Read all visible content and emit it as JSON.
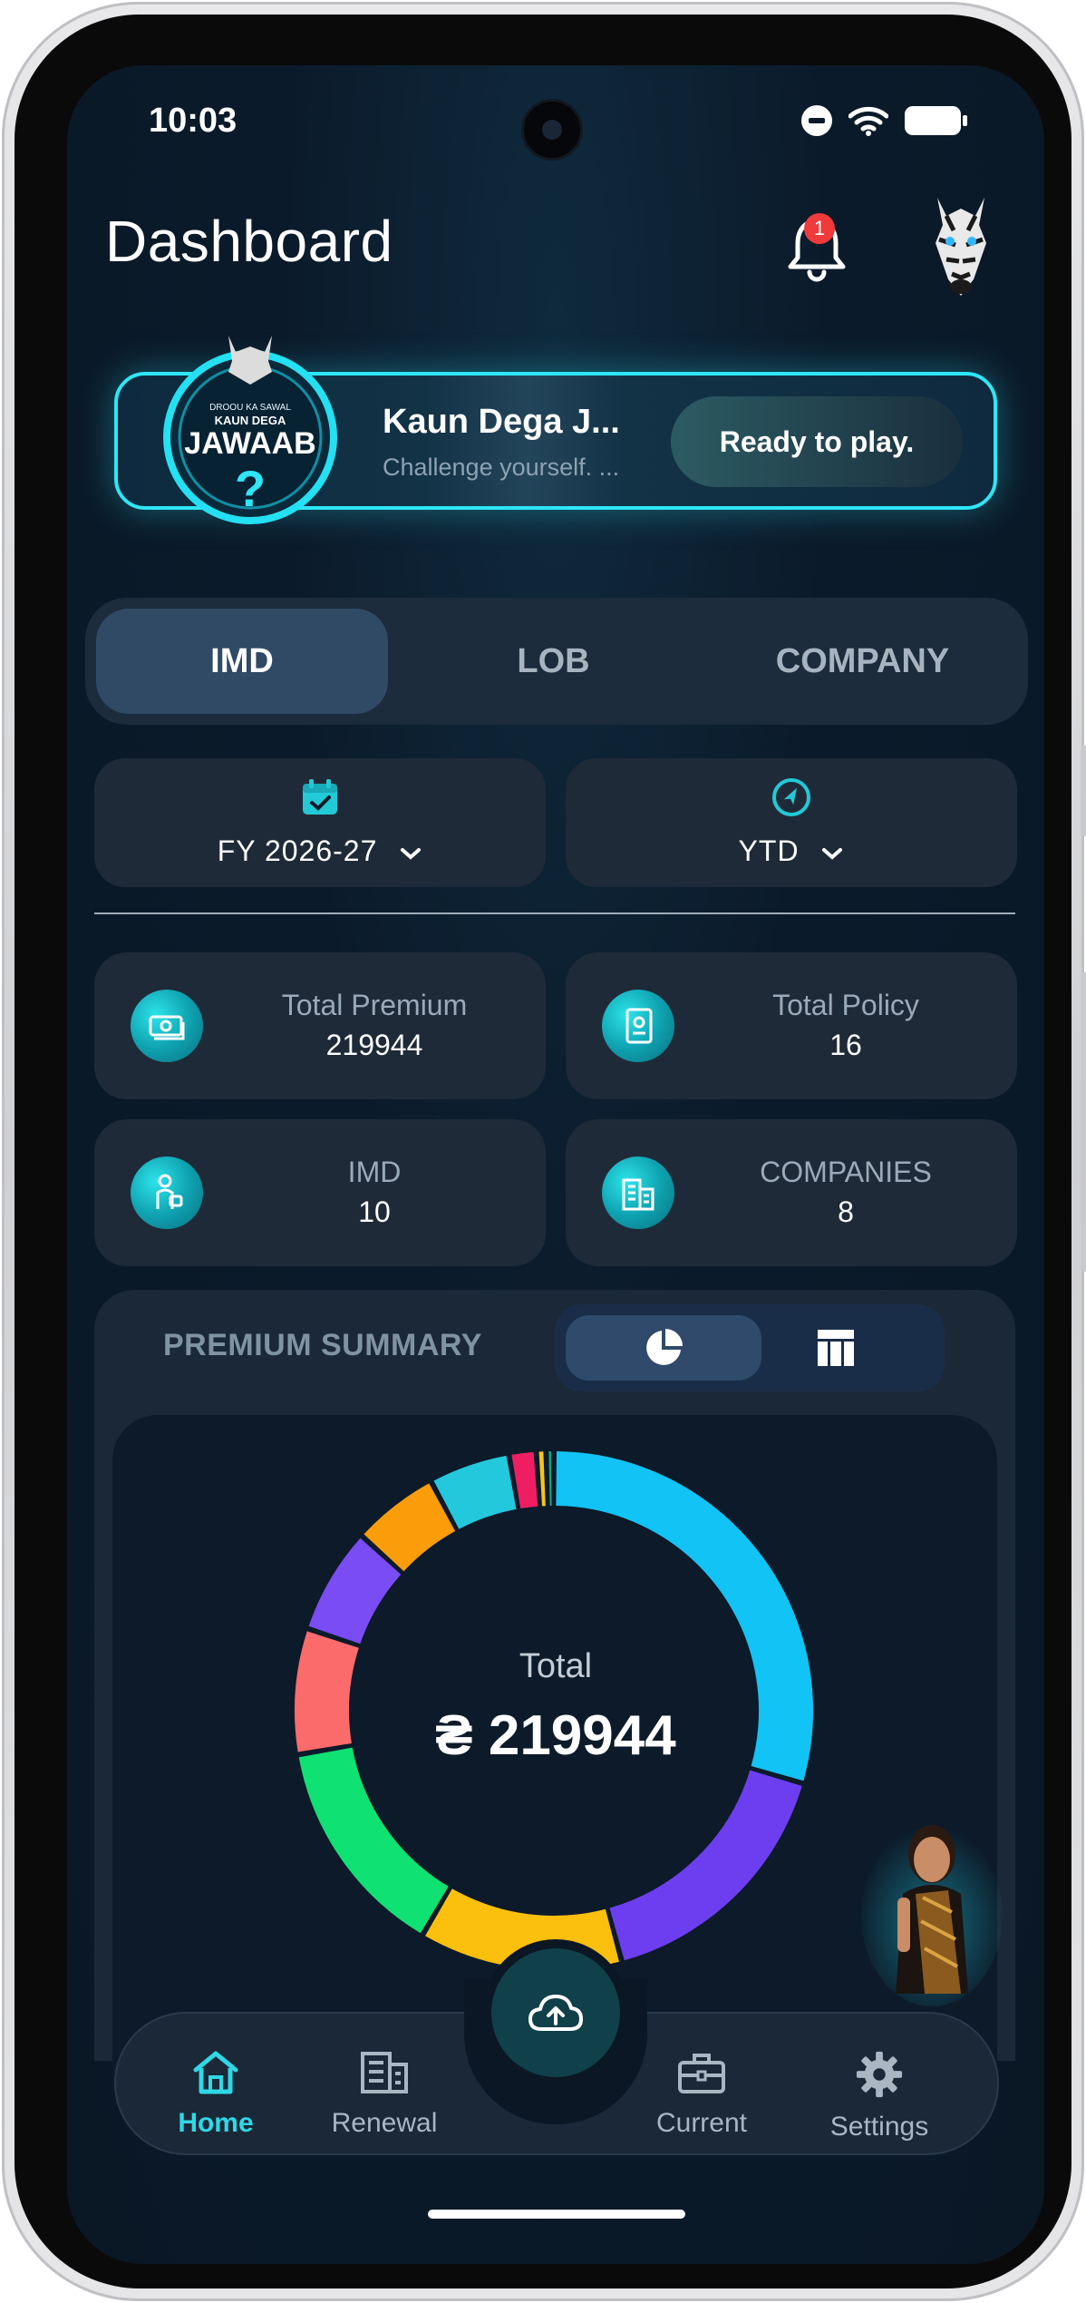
{
  "status": {
    "time": "10:03"
  },
  "header": {
    "title": "Dashboard",
    "notification_count": "1"
  },
  "banner": {
    "logo_text_top": "DROOU KA SAWAL",
    "logo_text_mid": "KAUN DEGA",
    "logo_text_main": "JAWAAB",
    "title": "Kaun Dega J...",
    "subtitle": "Challenge yourself. ...",
    "button_label": "Ready to play."
  },
  "tabs": [
    {
      "label": "IMD",
      "active": true
    },
    {
      "label": "LOB",
      "active": false
    },
    {
      "label": "COMPANY",
      "active": false
    }
  ],
  "filters": {
    "year": {
      "label": "FY 2026-27",
      "icon": "calendar-check-icon"
    },
    "period": {
      "label": "YTD",
      "icon": "compass-icon"
    }
  },
  "stats": [
    {
      "label": "Total Premium",
      "value": "219944",
      "icon": "money-icon"
    },
    {
      "label": "Total Policy",
      "value": "16",
      "icon": "policy-document-icon"
    },
    {
      "label": "IMD",
      "value": "10",
      "icon": "agent-icon"
    },
    {
      "label": "COMPANIES",
      "value": "8",
      "icon": "buildings-icon"
    }
  ],
  "summary": {
    "title": "PREMIUM SUMMARY",
    "view_options": [
      "pie-chart-icon",
      "table-icon"
    ],
    "active_view": "pie-chart-icon",
    "total_label": "Total",
    "total_value": "₴ 219944"
  },
  "chart_data": {
    "type": "pie",
    "style": "donut",
    "values": [
      24.5,
      13.5,
      10.5,
      11.5,
      6.5,
      5.5,
      4.5,
      4.2,
      1.4,
      0.5,
      0.4
    ],
    "colors": [
      "#12c3f5",
      "#6d3ef0",
      "#fbbf0e",
      "#0fe173",
      "#fc6b6b",
      "#7a4cf3",
      "#fb9c0a",
      "#23c8dd",
      "#ef1e63",
      "#f5c518",
      "#12a37a"
    ]
  },
  "nav": {
    "items": [
      {
        "label": "Home",
        "icon": "home-icon",
        "active": true
      },
      {
        "label": "Renewal",
        "icon": "building-list-icon",
        "active": false
      },
      {
        "label": "Current",
        "icon": "briefcase-icon",
        "active": false
      },
      {
        "label": "Settings",
        "icon": "gear-icon",
        "active": false
      }
    ],
    "fab_icon": "cloud-upload-icon"
  },
  "colors": {
    "accent": "#2fd8e6",
    "banner_border": "#2ee6f5",
    "background": "#0b1a2a"
  }
}
